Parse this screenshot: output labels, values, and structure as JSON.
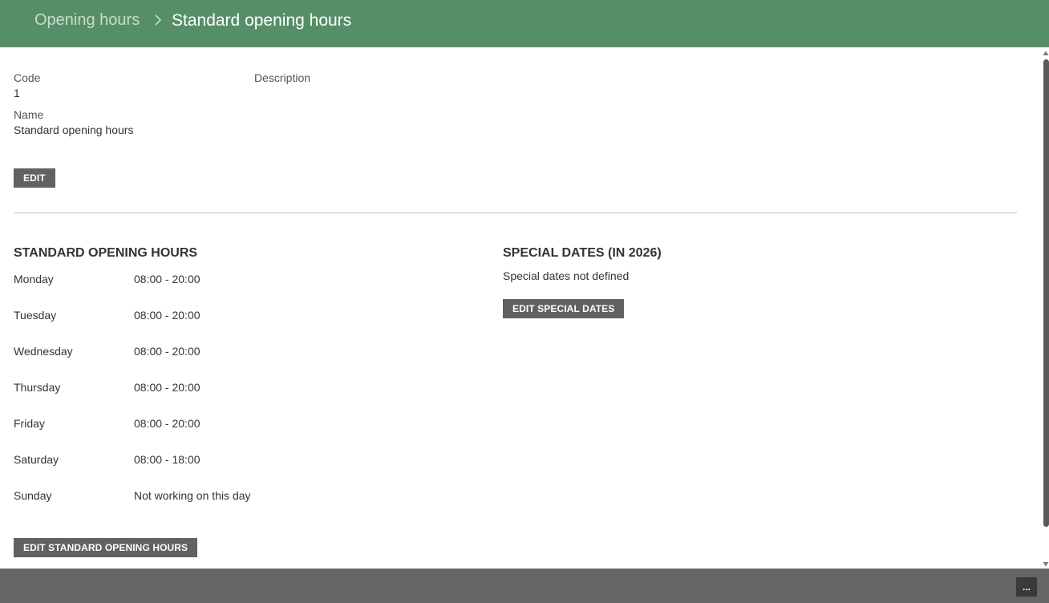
{
  "header": {
    "breadcrumb_parent": "Opening hours",
    "breadcrumb_current": "Standard opening hours",
    "background_color": "#568f67"
  },
  "details": {
    "code_label": "Code",
    "code_value": "1",
    "description_label": "Description",
    "name_label": "Name",
    "name_value": "Standard opening hours",
    "edit_button": "EDIT"
  },
  "standard_hours": {
    "title": "STANDARD OPENING HOURS",
    "days": [
      {
        "day": "Monday",
        "hours": "08:00 - 20:00"
      },
      {
        "day": "Tuesday",
        "hours": "08:00 - 20:00"
      },
      {
        "day": "Wednesday",
        "hours": "08:00 - 20:00"
      },
      {
        "day": "Thursday",
        "hours": "08:00 - 20:00"
      },
      {
        "day": "Friday",
        "hours": "08:00 - 20:00"
      },
      {
        "day": "Saturday",
        "hours": "08:00 - 18:00"
      },
      {
        "day": "Sunday",
        "hours": "Not working on this day"
      }
    ],
    "edit_button": "EDIT STANDARD OPENING HOURS"
  },
  "special_dates": {
    "title": "SPECIAL DATES (IN 2026)",
    "status": "Special dates not defined",
    "edit_button": "EDIT SPECIAL DATES"
  },
  "footer": {
    "more_button": "..."
  },
  "icons": {
    "breadcrumb_separator": "chevron-right-icon"
  }
}
